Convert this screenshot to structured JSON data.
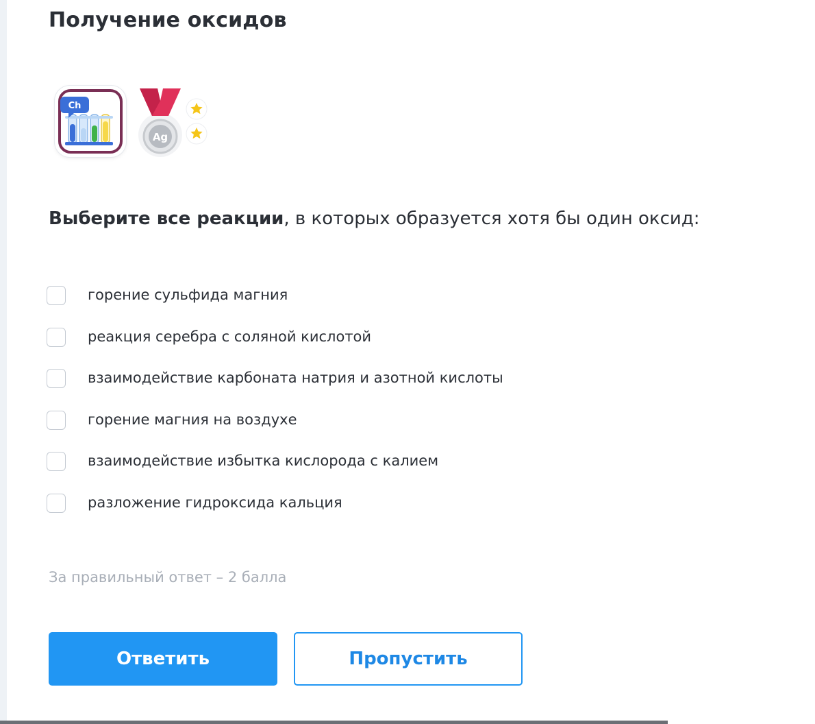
{
  "title": "Получение оксидов",
  "badges": {
    "lab_icon": "chemistry-lab-icon",
    "lab_label": "Ch",
    "medal_icon": "silver-medal-icon",
    "medal_label": "Ag",
    "stars": 2
  },
  "question": {
    "bold": "Выберите все реакции",
    "rest": ", в которых образуется хотя бы один оксид:"
  },
  "options": [
    {
      "label": "горение сульфида магния",
      "checked": false
    },
    {
      "label": "реакция серебра с соляной кислотой",
      "checked": false
    },
    {
      "label": "взаимодействие карбоната натрия и азотной кислоты",
      "checked": false
    },
    {
      "label": "горение магния на воздухе",
      "checked": false
    },
    {
      "label": "взаимодействие избытка кислорода с калием",
      "checked": false
    },
    {
      "label": "разложение гидроксида кальция",
      "checked": false
    }
  ],
  "score_note": "За правильный ответ – 2 балла",
  "buttons": {
    "answer": "Ответить",
    "skip": "Пропустить"
  },
  "colors": {
    "primary": "#2196f3",
    "text": "#2b2f36",
    "muted": "#a8aeb7",
    "checkbox_border": "#c5cbd3",
    "medal_ribbon": "#e0315a",
    "lab_frame": "#7a2f55"
  }
}
